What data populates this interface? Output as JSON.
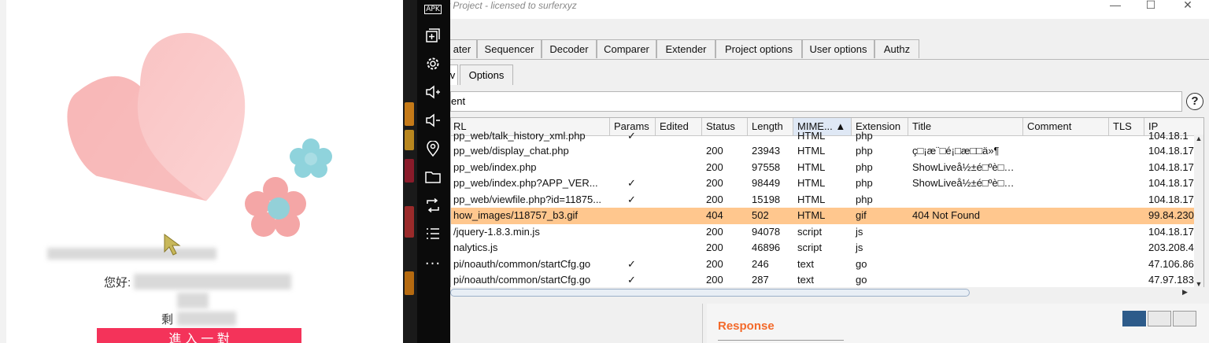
{
  "left_panel": {
    "greeting": "您好:",
    "remaining": "剩",
    "enter_button": "進 入 一 對"
  },
  "toolbar": {
    "icons": [
      "apk-icon",
      "add-window-icon",
      "settings-icon",
      "volume-up-icon",
      "volume-down-icon",
      "location-icon",
      "folder-icon",
      "rotate-icon",
      "list-icon",
      "more-icon"
    ],
    "apk_label": "APK",
    "more_label": "..."
  },
  "window": {
    "title": "y Project - licensed to surferxyz",
    "minimize": "—",
    "maximize": "☐",
    "close": "✕"
  },
  "main_tabs": [
    "ater",
    "Sequencer",
    "Decoder",
    "Comparer",
    "Extender",
    "Project options",
    "User options",
    "Authz"
  ],
  "sub_tabs": [
    "v",
    "Options"
  ],
  "filter": {
    "text": "ent"
  },
  "help_label": "?",
  "table": {
    "sorted_column": "MIME...",
    "columns": [
      "RL",
      "Params",
      "Edited",
      "Status",
      "Length",
      "MIME... ▲",
      "Extension",
      "Title",
      "Comment",
      "TLS",
      "IP"
    ],
    "rows": [
      {
        "url": "pp_web/talk_history_xml.php",
        "params": "✓",
        "edited": "",
        "status": "",
        "length": "",
        "mime": "HTML",
        "ext": "php",
        "title": "",
        "ip": "104.18.1"
      },
      {
        "url": "pp_web/display_chat.php",
        "params": "",
        "edited": "",
        "status": "200",
        "length": "23943",
        "mime": "HTML",
        "ext": "php",
        "title": "ç□¡æ¨□é¡□æ□□ä»¶",
        "ip": "104.18.17"
      },
      {
        "url": "pp_web/index.php",
        "params": "",
        "edited": "",
        "status": "200",
        "length": "97558",
        "mime": "HTML",
        "ext": "php",
        "title": "ShowLiveå½±é□ºè□…",
        "ip": "104.18.17"
      },
      {
        "url": "pp_web/index.php?APP_VER...",
        "params": "✓",
        "edited": "",
        "status": "200",
        "length": "98449",
        "mime": "HTML",
        "ext": "php",
        "title": "ShowLiveå½±é□ºè□…",
        "ip": "104.18.17"
      },
      {
        "url": "pp_web/viewfile.php?id=11875...",
        "params": "✓",
        "edited": "",
        "status": "200",
        "length": "15198",
        "mime": "HTML",
        "ext": "php",
        "title": "",
        "ip": "104.18.17"
      },
      {
        "url": "how_images/118757_b3.gif",
        "params": "",
        "edited": "",
        "status": "404",
        "length": "502",
        "mime": "HTML",
        "ext": "gif",
        "title": "404 Not Found",
        "ip": "99.84.230",
        "highlight": true
      },
      {
        "url": "/jquery-1.8.3.min.js",
        "params": "",
        "edited": "",
        "status": "200",
        "length": "94078",
        "mime": "script",
        "ext": "js",
        "title": "",
        "ip": "104.18.17"
      },
      {
        "url": "nalytics.js",
        "params": "",
        "edited": "",
        "status": "200",
        "length": "46896",
        "mime": "script",
        "ext": "js",
        "title": "",
        "ip": "203.208.4"
      },
      {
        "url": "pi/noauth/common/startCfg.go",
        "params": "✓",
        "edited": "",
        "status": "200",
        "length": "246",
        "mime": "text",
        "ext": "go",
        "title": "",
        "ip": "47.106.86"
      },
      {
        "url": "pi/noauth/common/startCfg.go",
        "params": "✓",
        "edited": "",
        "status": "200",
        "length": "287",
        "mime": "text",
        "ext": "go",
        "title": "",
        "ip": "47.97.183"
      }
    ]
  },
  "response": {
    "title": "Response"
  },
  "scroll": {
    "up": "▲",
    "down": "▼",
    "right": "▶"
  },
  "colors": {
    "highlight_row": "#ffc78e",
    "response_title": "#f36a2b",
    "enter_button": "#f4335a"
  }
}
